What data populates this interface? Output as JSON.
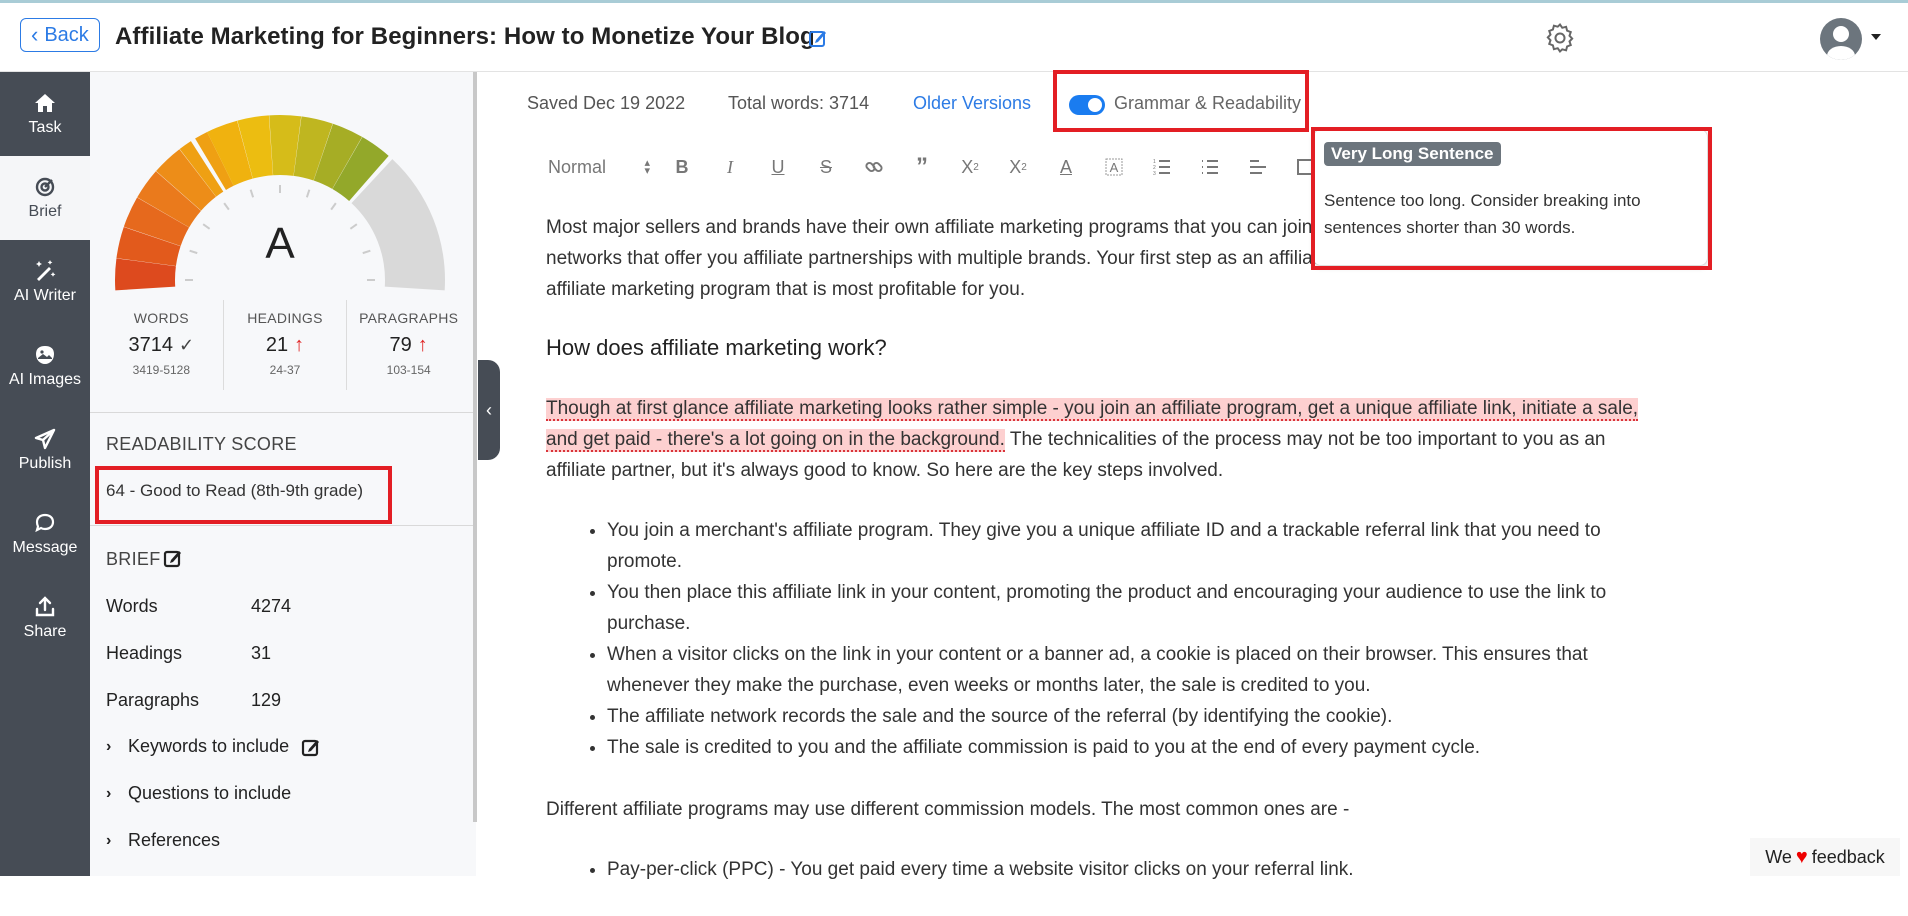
{
  "header": {
    "back_label": "Back",
    "title": "Affiliate Marketing for Beginners: How to Monetize Your Blog"
  },
  "sidebar": {
    "items": [
      {
        "label": "Task",
        "icon": "home-icon"
      },
      {
        "label": "Brief",
        "icon": "target-icon",
        "active": true
      },
      {
        "label": "AI Writer",
        "icon": "magic-wand-icon"
      },
      {
        "label": "AI Images",
        "icon": "image-icon"
      },
      {
        "label": "Publish",
        "icon": "paper-plane-icon"
      },
      {
        "label": "Message",
        "icon": "chat-bubble-icon"
      },
      {
        "label": "Share",
        "icon": "upload-icon"
      }
    ]
  },
  "panel": {
    "gauge": {
      "grade": "A",
      "score_fraction": 0.72
    },
    "stats": [
      {
        "label": "WORDS",
        "value": "3714",
        "status": "check",
        "range": "3419-5128"
      },
      {
        "label": "HEADINGS",
        "value": "21",
        "status": "up",
        "range": "24-37"
      },
      {
        "label": "PARAGRAPHS",
        "value": "79",
        "status": "up",
        "range": "103-154"
      }
    ],
    "readability": {
      "title": "READABILITY SCORE",
      "value": "64 - Good to Read (8th-9th grade)"
    },
    "brief": {
      "title": "BRIEF",
      "rows": [
        {
          "label": "Words",
          "value": "4274"
        },
        {
          "label": "Headings",
          "value": "31"
        },
        {
          "label": "Paragraphs",
          "value": "129"
        }
      ],
      "collapsibles": [
        {
          "label": "Keywords to include",
          "editable": true
        },
        {
          "label": "Questions to include"
        },
        {
          "label": "References"
        }
      ]
    }
  },
  "editor_meta": {
    "saved": "Saved Dec 19 2022",
    "total_words": "Total words: 3714",
    "older_versions": "Older Versions",
    "grammar_toggle_label": "Grammar & Readability",
    "grammar_toggle_on": true
  },
  "toolbar": {
    "format_select": "Normal",
    "buttons": [
      "bold",
      "italic",
      "underline",
      "strikethrough",
      "link",
      "blockquote",
      "subscript",
      "superscript",
      "text-color",
      "highlight",
      "ordered-list",
      "bullet-list",
      "align",
      "image"
    ]
  },
  "content": {
    "p1": "Most major sellers and brands have their own affiliate marketing programs that you can join. There are also affiliate marketing networks that offer you affiliate partnerships with multiple brands. Your first step as an affiliate marketer would be to choose an affiliate marketing program that is most profitable for you.",
    "h2": "How does affiliate marketing work?",
    "p2_flagged": "Though at first glance affiliate marketing looks rather simple - you join an affiliate program, get a unique affiliate link, initiate a sale, and get paid - there's a lot going on in the background.",
    "p2_rest": " The technicalities of the process may not be too important to you as an affiliate partner, but it's always good to know. So here are the key steps involved.",
    "steps": [
      "You join a merchant's affiliate program. They give you a unique affiliate ID and a trackable referral link that you need to promote.",
      "You then place this affiliate link in your content, promoting the product and encouraging your audience to use the link to purchase.",
      "When a visitor clicks on the link in your content or a banner ad, a cookie is placed on their browser. This ensures that whenever they make the purchase, even weeks or months later, the sale is credited to you.",
      "The affiliate network records the sale and the source of the referral (by identifying the cookie).",
      "The sale is credited to you and the affiliate commission is paid to you at the end of every payment cycle."
    ],
    "p3": "Different affiliate programs may use different commission models. The most common ones are -",
    "models": [
      "Pay-per-click (PPC) - You get paid every time a website visitor clicks on your referral link."
    ]
  },
  "tooltip": {
    "badge": "Very Long Sentence",
    "message": "Sentence too long. Consider breaking into sentences shorter than 30 words."
  },
  "feedback": {
    "prefix": "We",
    "suffix": "feedback"
  }
}
